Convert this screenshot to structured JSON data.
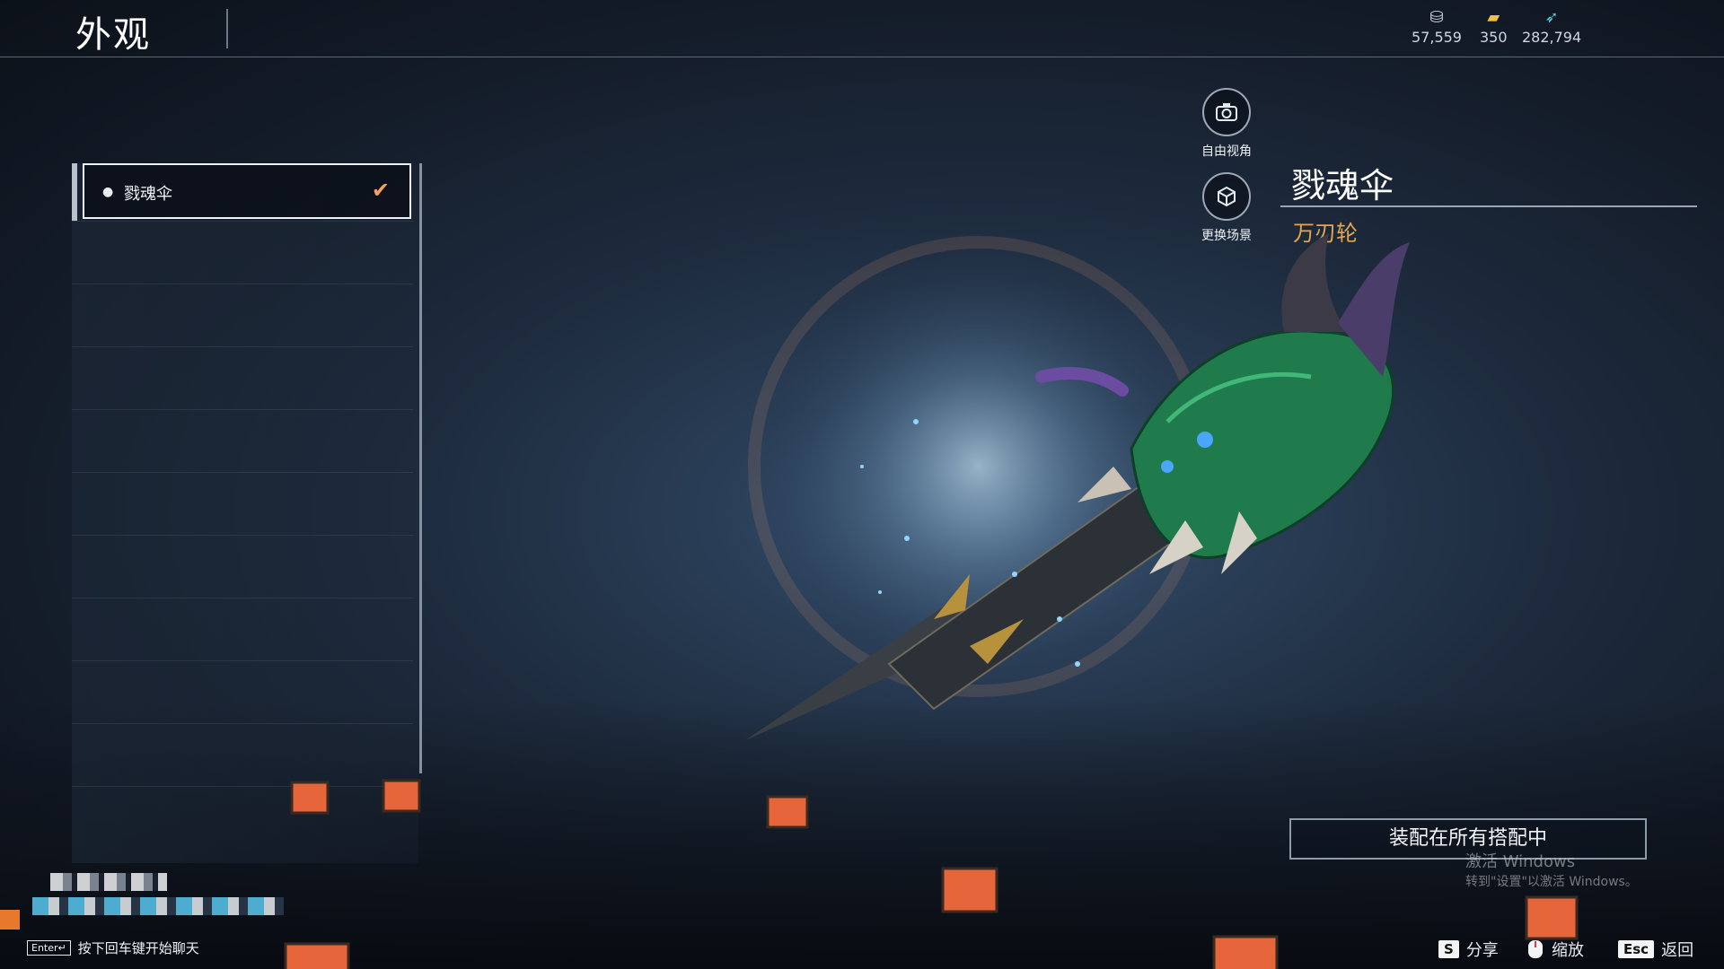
{
  "header": {
    "title": "外观"
  },
  "currencies": [
    {
      "icon": "silver-coin-icon",
      "value": "57,559"
    },
    {
      "icon": "gold-ticket-icon",
      "value": "350"
    },
    {
      "icon": "jade-feather-icon",
      "value": "282,794"
    }
  ],
  "list": {
    "items": [
      {
        "label": "戮魂伞",
        "selected": true
      }
    ]
  },
  "actions": {
    "free_camera": "自由视角",
    "change_scene": "更换场景"
  },
  "item": {
    "name": "戮魂伞",
    "type": "万刃轮"
  },
  "equip_button": "装配在所有搭配中",
  "watermark": {
    "line1": "激活 Windows",
    "line2": "转到\"设置\"以激活 Windows。"
  },
  "chat": {
    "key": "Enter↵",
    "hint": "按下回车键开始聊天"
  },
  "footer": {
    "share_key": "S",
    "share": "分享",
    "zoom": "缩放",
    "back_key": "Esc",
    "back": "返回"
  },
  "colors": {
    "accent": "#f3a35b",
    "item_type": "#e5a64c"
  }
}
